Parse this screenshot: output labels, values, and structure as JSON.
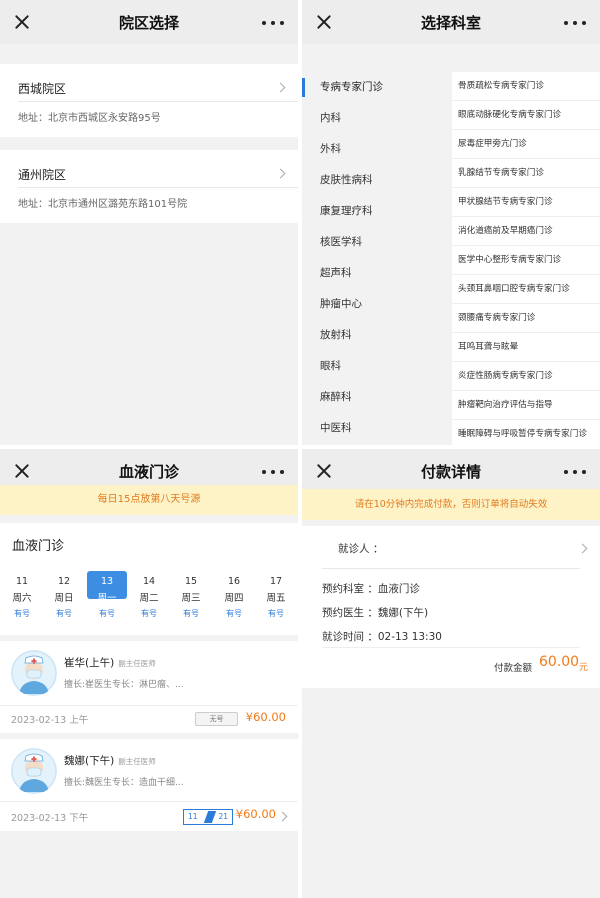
{
  "campus_page": {
    "title": "院区选择",
    "campuses": [
      {
        "name": "西城院区",
        "address": "地址：北京市西城区永安路95号"
      },
      {
        "name": "通州院区",
        "address": "地址：北京市通州区潞苑东路101号院"
      }
    ]
  },
  "dept_page": {
    "title": "选择科室",
    "departments": [
      "专病专家门诊",
      "内科",
      "外科",
      "皮肤性病科",
      "康复理疗科",
      "核医学科",
      "超声科",
      "肿瘤中心",
      "放射科",
      "眼科",
      "麻醉科",
      "中医科"
    ],
    "active_department": "专病专家门诊",
    "sub_clinics": [
      "骨质疏松专病专家门诊",
      "眼底动脉硬化专病专家门诊",
      "尿毒症甲旁亢门诊",
      "乳腺结节专病专家门诊",
      "甲状腺结节专病专家门诊",
      "消化道癌前及早期癌门诊",
      "医学中心整形专病专家门诊",
      "头颈耳鼻咽口腔专病专家门诊",
      "颈腰痛专病专家门诊",
      "耳鸣耳聋与眩晕",
      "炎症性肠病专病专家门诊",
      "肿瘤靶向治疗评估与指导",
      "睡眠障碍与呼吸暂停专病专家门诊"
    ]
  },
  "schedule_page": {
    "title": "血液门诊",
    "notice": "每日15点放第八天号源",
    "department": "血液门诊",
    "dates": [
      {
        "day": "11",
        "weekday": "周六",
        "status": "有号"
      },
      {
        "day": "12",
        "weekday": "周日",
        "status": "有号"
      },
      {
        "day": "13",
        "weekday": "周一",
        "status": "有号",
        "selected": true
      },
      {
        "day": "14",
        "weekday": "周二",
        "status": "有号"
      },
      {
        "day": "15",
        "weekday": "周三",
        "status": "有号"
      },
      {
        "day": "16",
        "weekday": "周四",
        "status": "有号"
      },
      {
        "day": "17",
        "weekday": "周五",
        "status": "有号"
      }
    ],
    "doctors": [
      {
        "name": "崔华(上午)",
        "title": "副主任医师",
        "skill": "擅长:崔医生专长：淋巴瘤、...",
        "date": "2023-02-13 上午",
        "status": "无号",
        "price": "¥60.00"
      },
      {
        "name": "魏娜(下午)",
        "title": "副主任医师",
        "skill": "擅长:魏医生专长：造血干细...",
        "date": "2023-02-13 下午",
        "remaining": "11",
        "total": "21",
        "price": "¥60.00"
      }
    ]
  },
  "payment_page": {
    "title": "付款详情",
    "notice": "请在10分钟内完成付款，否则订单将自动失效",
    "patient_label": "就诊人 ：",
    "rows": [
      {
        "label": "预约科室",
        "value": "：血液门诊"
      },
      {
        "label": "预约医生",
        "value": "：魏娜(下午)"
      },
      {
        "label": "就诊时间",
        "value": "：02-13 13:30"
      }
    ],
    "amount_label": "付款金额",
    "amount": "60.00",
    "unit": "元"
  },
  "colors": {
    "accent_blue": "#2b7bd8",
    "price_orange": "#f07b18",
    "notice_bg": "#fdf3c6"
  }
}
